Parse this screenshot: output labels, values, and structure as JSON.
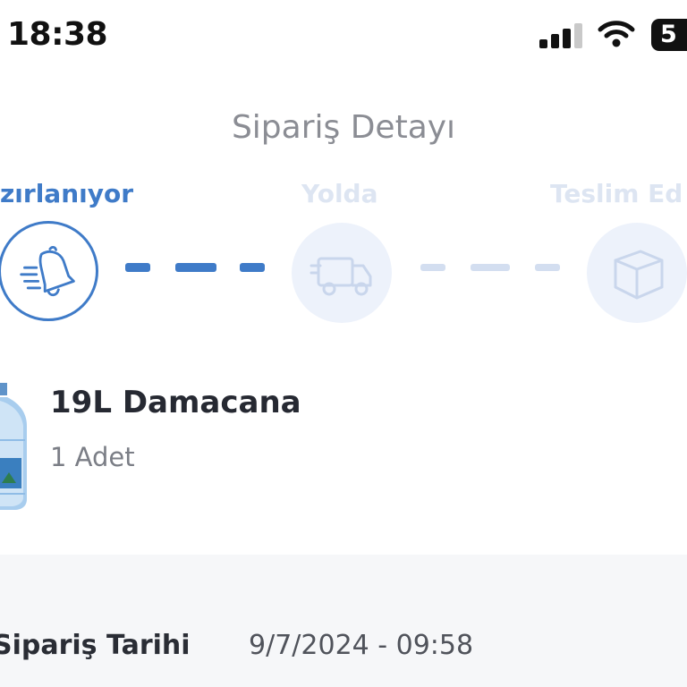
{
  "status_bar": {
    "time": "18:38",
    "battery_text": "5",
    "icons": [
      "signal-icon",
      "wifi-icon",
      "battery-icon"
    ]
  },
  "page": {
    "title": "Sipariş Detayı"
  },
  "steps": [
    {
      "label": "zırlanıyor",
      "state": "active",
      "icon": "bell-icon"
    },
    {
      "label": "Yolda",
      "state": "inactive",
      "icon": "truck-icon"
    },
    {
      "label": "Teslim Ed",
      "state": "inactive",
      "icon": "package-icon"
    }
  ],
  "product": {
    "name": "19L Damacana",
    "quantity": "1 Adet",
    "icon": "water-bottle-icon"
  },
  "order_info": {
    "date_label": "Sipariş Tarihi",
    "date_value": "9/7/2024 - 09:58"
  },
  "colors": {
    "accent": "#3f7bc8",
    "inactive_text": "#dde5f2",
    "inactive_circle": "#edf2fb",
    "title_gray": "#8b8d94",
    "section_bg": "#f6f7f9"
  }
}
